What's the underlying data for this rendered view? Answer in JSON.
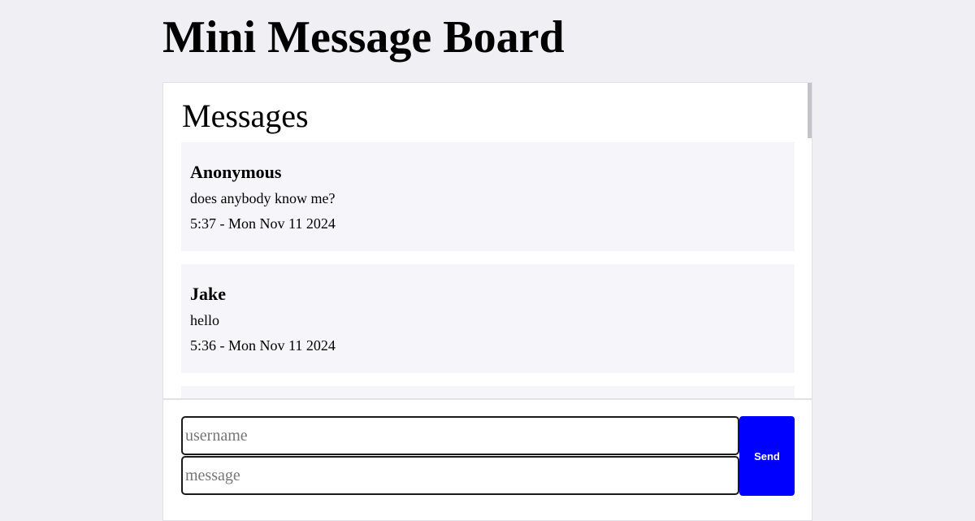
{
  "page": {
    "title": "Mini Message Board"
  },
  "board": {
    "heading": "Messages",
    "messages": [
      {
        "user": "Anonymous",
        "text": "does anybody know me?",
        "time": "5:37 - Mon Nov 11 2024"
      },
      {
        "user": "Jake",
        "text": "hello",
        "time": "5:36 - Mon Nov 11 2024"
      },
      {
        "user": "",
        "text": "",
        "time": ""
      }
    ]
  },
  "composer": {
    "username_placeholder": "username",
    "username_value": "",
    "message_placeholder": "message",
    "message_value": "",
    "send_label": "Send"
  },
  "colors": {
    "page_background": "#f0eff4",
    "card_background": "#ffffff",
    "message_background": "#f6f6fa",
    "send_button": "#0000ff",
    "send_text": "#ffffff"
  }
}
